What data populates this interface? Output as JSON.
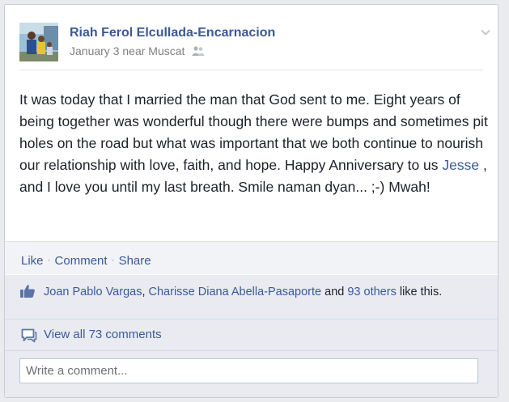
{
  "post": {
    "author": "Riah Ferol Elcullada-Encarnacion",
    "timestamp": "January 3 near Muscat",
    "audience_icon": "friends-icon",
    "body_before": "It was today that I married the man that God sent to me. Eight years of being together was wonderful though there were bumps and sometimes pit holes on the road but what was important that we both continue to nourish our relationship with love, faith, and hope. Happy Anniversary to us ",
    "mention": "Jesse",
    "body_after": " , and I love you until my last breath. Smile naman dyan... ;-) Mwah!"
  },
  "actions": {
    "like": "Like",
    "separator": "·",
    "comment": "Comment",
    "share": "Share"
  },
  "likes": {
    "icon": "thumbs-up-icon",
    "person1": "Joan Pablo Vargas",
    "comma": ", ",
    "person2": "Charisse Diana Abella-Pasaporte",
    "and": " and ",
    "others": "93 others",
    "suffix": " like this."
  },
  "comments": {
    "icon": "comment-bubble-icon",
    "view_all": "View all 73 comments"
  },
  "write_comment": {
    "placeholder": "Write a comment..."
  },
  "colors": {
    "link": "#3b5998",
    "text": "#1d2129",
    "meta": "#7f7f7f",
    "footer_bg": "#e9ebf1"
  }
}
